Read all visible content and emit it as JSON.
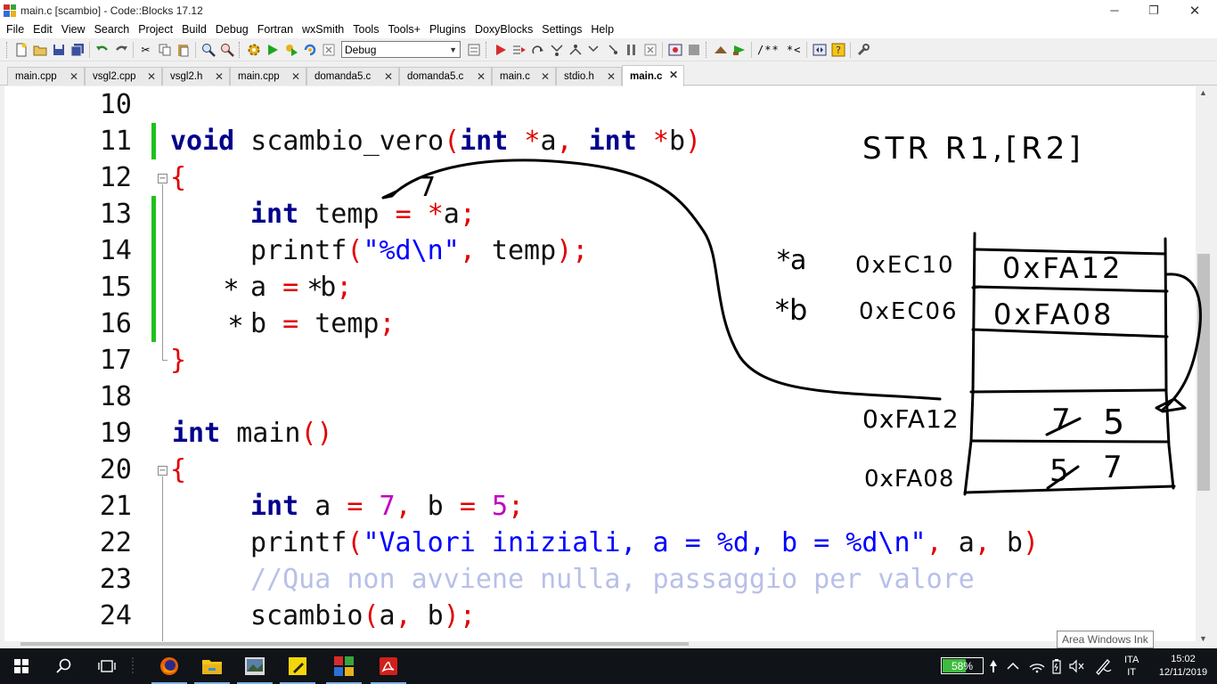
{
  "window": {
    "title": "main.c [scambio] - Code::Blocks 17.12",
    "minimize": "─",
    "maximize": "❐",
    "close": "✕"
  },
  "menu": [
    "File",
    "Edit",
    "View",
    "Search",
    "Project",
    "Build",
    "Debug",
    "Fortran",
    "wxSmith",
    "Tools",
    "Tools+",
    "Plugins",
    "DoxyBlocks",
    "Settings",
    "Help"
  ],
  "toolbar": {
    "build_target": "Debug",
    "doxy_comment": "/** *<"
  },
  "tabs": [
    {
      "label": "main.cpp",
      "active": false
    },
    {
      "label": "vsgl2.cpp",
      "active": false
    },
    {
      "label": "vsgl2.h",
      "active": false
    },
    {
      "label": "main.cpp",
      "active": false
    },
    {
      "label": "domanda5.c",
      "active": false
    },
    {
      "label": "domanda5.c",
      "active": false
    },
    {
      "label": "main.c",
      "active": false
    },
    {
      "label": "stdio.h",
      "active": false
    },
    {
      "label": "main.c",
      "active": true
    }
  ],
  "editor": {
    "line_numbers": [
      "10",
      "11",
      "12",
      "13",
      "14",
      "15",
      "16",
      "17",
      "18",
      "19",
      "20",
      "21",
      "22",
      "23",
      "24"
    ],
    "l11": {
      "kw1": "void",
      "name": " scambio_vero",
      "p1": "(",
      "kw2": "int",
      "s1": " ",
      "star1": "*",
      "a": "a",
      "comma": ",",
      "s2": " ",
      "kw3": "int",
      "s3": " ",
      "star2": "*",
      "b": "b",
      "p2": ")"
    },
    "l12": {
      "brace": "{"
    },
    "l13": {
      "kw": "int",
      "rest": " temp ",
      "eq": "=",
      "s": " ",
      "star": "*",
      "a": "a",
      "semi": ";"
    },
    "l14": {
      "fn": "printf",
      "p1": "(",
      "str": "\"%d\\n\"",
      "comma": ",",
      "rest": " temp",
      "p2": ")",
      "semi": ";"
    },
    "l15": {
      "a": "a ",
      "eq": "=",
      "b": "b",
      "semi": ";"
    },
    "l16": {
      "b": "b ",
      "eq": "=",
      "rest": " temp",
      "semi": ";"
    },
    "l17": {
      "brace": "}"
    },
    "l19": {
      "kw": "int",
      "rest": " main",
      "paren": "()"
    },
    "l20": {
      "brace": "{"
    },
    "l21": {
      "kw": "int",
      "a": " a ",
      "eq1": "=",
      "s1": " ",
      "n1": "7",
      "comma": ",",
      "b": " b ",
      "eq2": "=",
      "s2": " ",
      "n2": "5",
      "semi": ";"
    },
    "l22": {
      "fn": "printf",
      "p1": "(",
      "str": "\"Valori iniziali, a = %d, b = %d\\n\"",
      "c1": ",",
      "a": " a",
      "c2": ",",
      "b": " b",
      "p2": ")"
    },
    "l23": {
      "comment": "//Qua non avviene nulla, passaggio per valore"
    },
    "l24": {
      "fn": "scambio",
      "p1": "(",
      "a": "a",
      "comma": ",",
      "b": " b",
      "p2": ")",
      "semi": ";"
    }
  },
  "ink": {
    "instruction": "STR R1,[R2]",
    "label_pa": "*a",
    "label_pb": "*b",
    "addr_a": "0xEC10",
    "addr_b": "0xEC06",
    "cell_a_value": "0xFA12",
    "cell_b_value": "0xFA08",
    "addr_fa12": "0xFA12",
    "addr_fa08": "0xFA08",
    "fa12_old": "7",
    "fa12_new": "5",
    "fa08_old": "5",
    "fa08_new": "7",
    "temp_value": "7",
    "star15a": "*",
    "star15b": "*",
    "star16": "*"
  },
  "tooltip": "Area Windows Ink",
  "taskbar": {
    "battery": "58%",
    "lang_top": "ITA",
    "lang_bottom": "IT",
    "time": "15:02",
    "date": "12/11/2019"
  }
}
